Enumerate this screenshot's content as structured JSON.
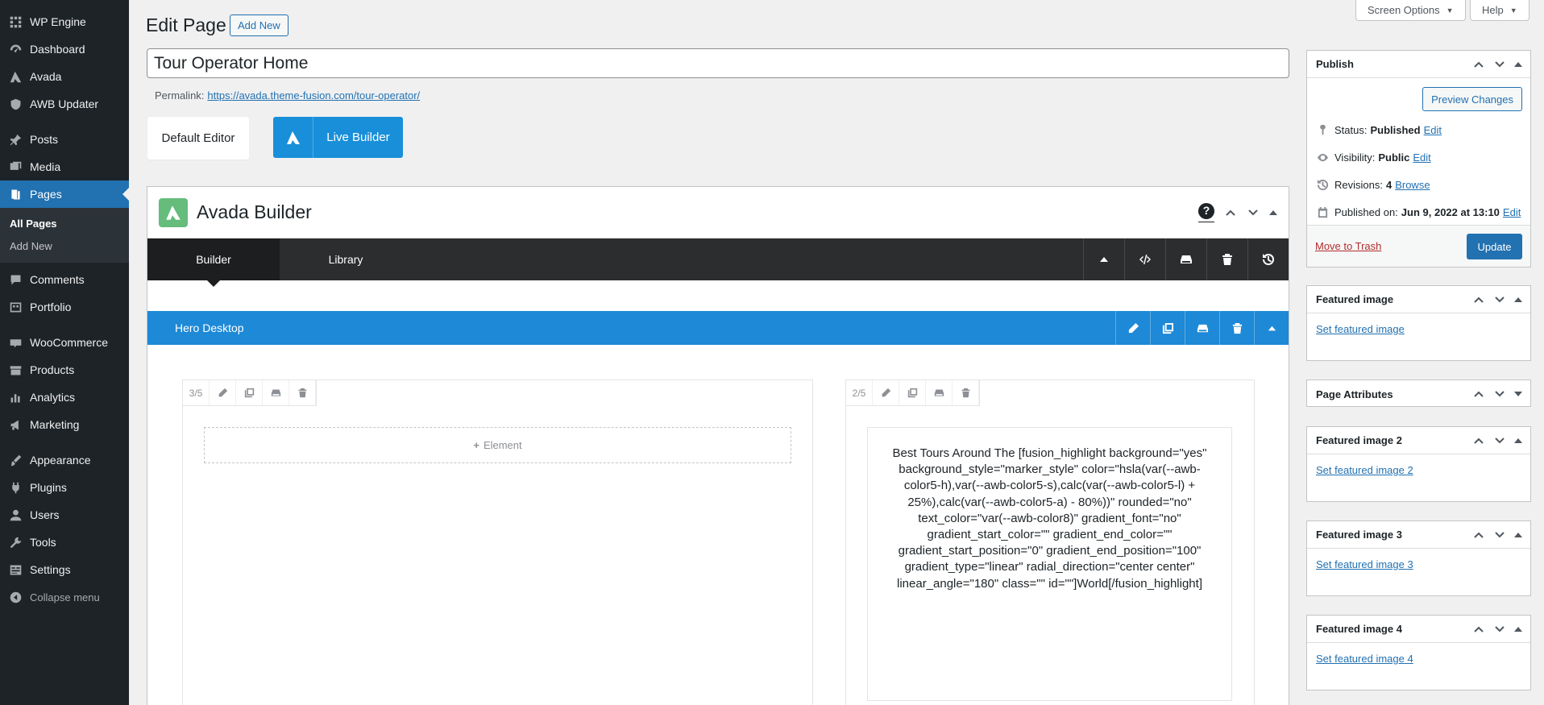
{
  "sidebar": {
    "items": [
      {
        "label": "WP Engine",
        "icon": "wp-engine-icon"
      },
      {
        "label": "Dashboard",
        "icon": "dashboard-icon"
      },
      {
        "label": "Avada",
        "icon": "avada-icon"
      },
      {
        "label": "AWB Updater",
        "icon": "updater-icon"
      },
      {
        "label": "Posts",
        "icon": "pin-icon"
      },
      {
        "label": "Media",
        "icon": "media-icon"
      },
      {
        "label": "Pages",
        "icon": "pages-icon"
      },
      {
        "label": "Comments",
        "icon": "comments-icon"
      },
      {
        "label": "Portfolio",
        "icon": "portfolio-icon"
      },
      {
        "label": "WooCommerce",
        "icon": "woocommerce-icon"
      },
      {
        "label": "Products",
        "icon": "products-icon"
      },
      {
        "label": "Analytics",
        "icon": "analytics-icon"
      },
      {
        "label": "Marketing",
        "icon": "marketing-icon"
      },
      {
        "label": "Appearance",
        "icon": "appearance-icon"
      },
      {
        "label": "Plugins",
        "icon": "plugins-icon"
      },
      {
        "label": "Users",
        "icon": "users-icon"
      },
      {
        "label": "Tools",
        "icon": "tools-icon"
      },
      {
        "label": "Settings",
        "icon": "settings-icon"
      }
    ],
    "submenu": [
      "All Pages",
      "Add New"
    ],
    "collapse_label": "Collapse menu"
  },
  "topbar": {
    "screen_options": "Screen Options",
    "help": "Help"
  },
  "header": {
    "title": "Edit Page",
    "add_new": "Add New"
  },
  "post": {
    "title": "Tour Operator Home",
    "permalink_label": "Permalink:",
    "permalink_url": "https://avada.theme-fusion.com/tour-operator/"
  },
  "editor_switch": {
    "default": "Default Editor",
    "live": "Live Builder"
  },
  "builder": {
    "title": "Avada Builder",
    "help": "?",
    "tabs": [
      "Builder",
      "Library"
    ],
    "container_title": "Hero Desktop",
    "col1_size": "3/5",
    "col2_size": "2/5",
    "add_element": "Element",
    "text_content": "Best Tours Around The [fusion_highlight background=\"yes\" background_style=\"marker_style\" color=\"hsla(var(--awb-color5-h),var(--awb-color5-s),calc(var(--awb-color5-l) + 25%),calc(var(--awb-color5-a) - 80%))\" rounded=\"no\" text_color=\"var(--awb-color8)\" gradient_font=\"no\" gradient_start_color=\"\" gradient_end_color=\"\" gradient_start_position=\"0\" gradient_end_position=\"100\" gradient_type=\"linear\" radial_direction=\"center center\" linear_angle=\"180\" class=\"\" id=\"\"]World[/fusion_highlight]"
  },
  "publish": {
    "title": "Publish",
    "preview": "Preview Changes",
    "status_label": "Status:",
    "status_value": "Published",
    "status_edit": "Edit",
    "visibility_label": "Visibility:",
    "visibility_value": "Public",
    "visibility_edit": "Edit",
    "revisions_label": "Revisions:",
    "revisions_value": "4",
    "revisions_browse": "Browse",
    "published_label": "Published on:",
    "published_value": "Jun 9, 2022 at 13:10",
    "published_edit": "Edit",
    "trash": "Move to Trash",
    "update": "Update"
  },
  "side_boxes": [
    {
      "title": "Featured image",
      "link": "Set featured image"
    },
    {
      "title": "Page Attributes",
      "link": ""
    },
    {
      "title": "Featured image 2",
      "link": "Set featured image 2"
    },
    {
      "title": "Featured image 3",
      "link": "Set featured image 3"
    },
    {
      "title": "Featured image 4",
      "link": "Set featured image 4"
    }
  ],
  "colors": {
    "admin_blue": "#2271b1",
    "hero_blue": "#1d89d7",
    "live_builder": "#198fd9",
    "avada_green": "#65bc7b",
    "sidebar_bg": "#1d2327"
  }
}
